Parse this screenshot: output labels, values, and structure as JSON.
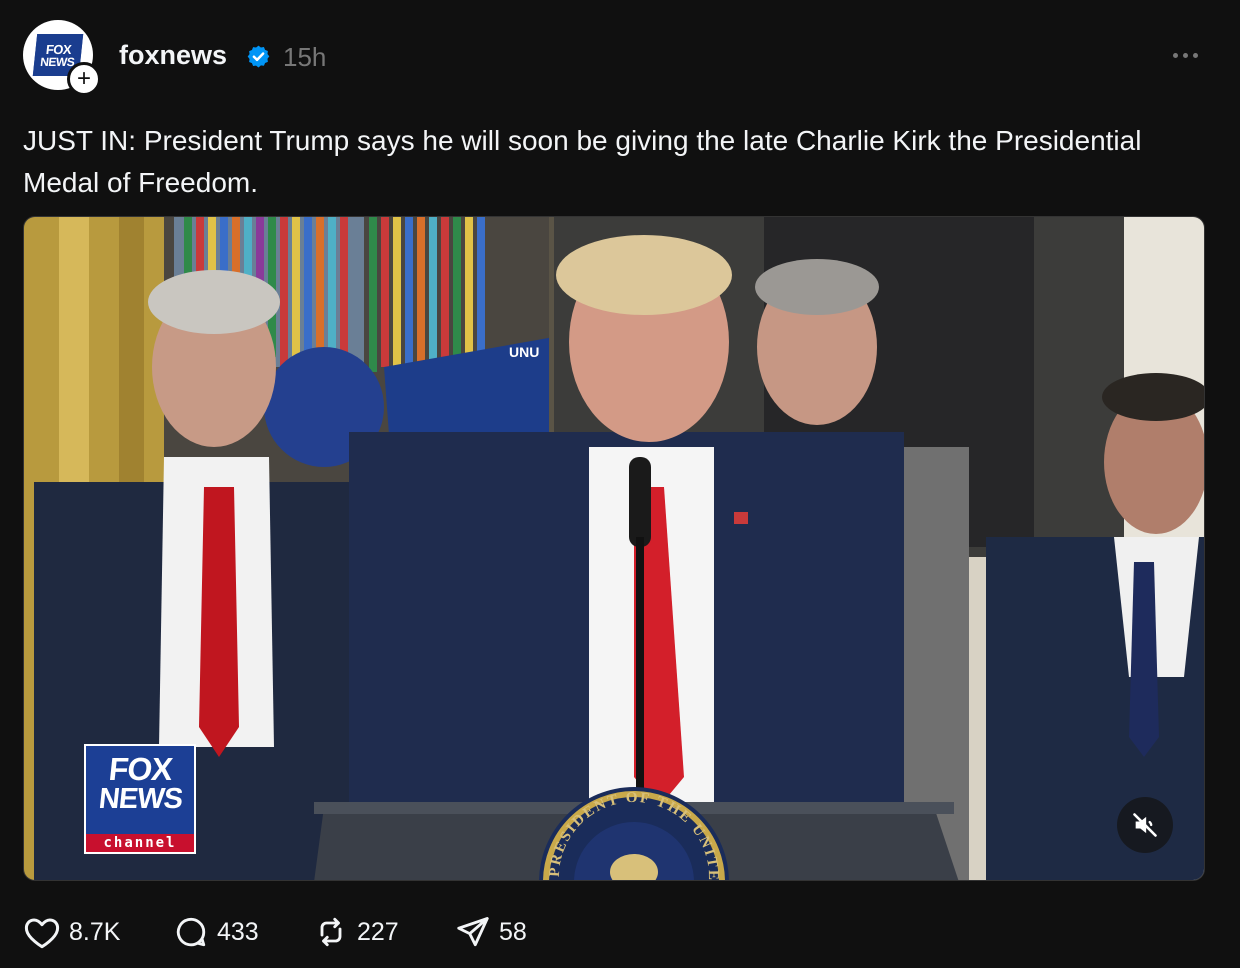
{
  "post": {
    "account": {
      "username": "foxnews",
      "verified": true,
      "timestamp": "15h",
      "avatar_logo_line1": "FOX",
      "avatar_logo_line2": "NEWS",
      "follow_symbol": "+"
    },
    "caption": "JUST IN: President Trump says he will soon be giving the late Charlie Kirk the Presidential Medal of Freedom.",
    "media": {
      "type": "video",
      "muted": true,
      "overlay_logo": {
        "line1": "FOX",
        "line2": "NEWS",
        "line3": "channel"
      },
      "seal_text": "PRESIDENT OF THE UNITED",
      "flag_text": "UNU"
    },
    "stats": {
      "likes": "8.7K",
      "replies": "433",
      "reposts": "227",
      "shares": "58"
    },
    "icons": [
      "verified-badge-icon",
      "more-icon",
      "mute-icon",
      "heart-icon",
      "comment-icon",
      "repost-icon",
      "share-icon"
    ],
    "colors": {
      "background": "#101010",
      "text": "#f3f5f7",
      "muted_text": "#777777",
      "verified": "#0095f6",
      "fox_blue": "#1c3f95",
      "fox_red": "#c8102e"
    }
  }
}
